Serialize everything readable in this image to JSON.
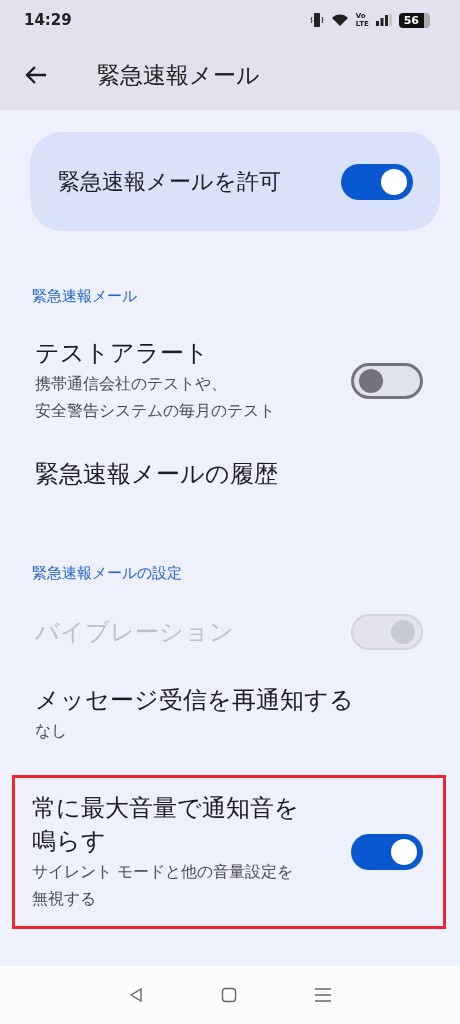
{
  "status_bar": {
    "time": "14:29",
    "volte": [
      "Vo",
      "LTE"
    ],
    "battery": "56"
  },
  "header": {
    "title": "緊急速報メール"
  },
  "master": {
    "label": "緊急速報メールを許可",
    "on": true
  },
  "sections": [
    {
      "title": "緊急速報メール",
      "items": [
        {
          "kind": "switch",
          "title": "テストアラート",
          "summary": [
            "携帯通信会社のテストや、",
            "安全警告システムの毎月のテスト"
          ],
          "on": false,
          "disabled": false,
          "highlighted": false
        },
        {
          "kind": "link",
          "title": "緊急速報メールの履歴",
          "disabled": false,
          "highlighted": false
        }
      ]
    },
    {
      "title": "緊急速報メールの設定",
      "items": [
        {
          "kind": "switch",
          "title": "バイブレーション",
          "on": true,
          "disabled": true,
          "highlighted": false
        },
        {
          "kind": "link",
          "title": "メッセージ受信を再通知する",
          "summary": [
            "なし"
          ],
          "disabled": false,
          "highlighted": false
        },
        {
          "kind": "switch",
          "title": "常に最大音量で通知音を鳴らす",
          "summary": [
            "サイレント モードと他の音量設定を",
            "無視する"
          ],
          "on": true,
          "disabled": false,
          "highlighted": true
        }
      ]
    }
  ]
}
